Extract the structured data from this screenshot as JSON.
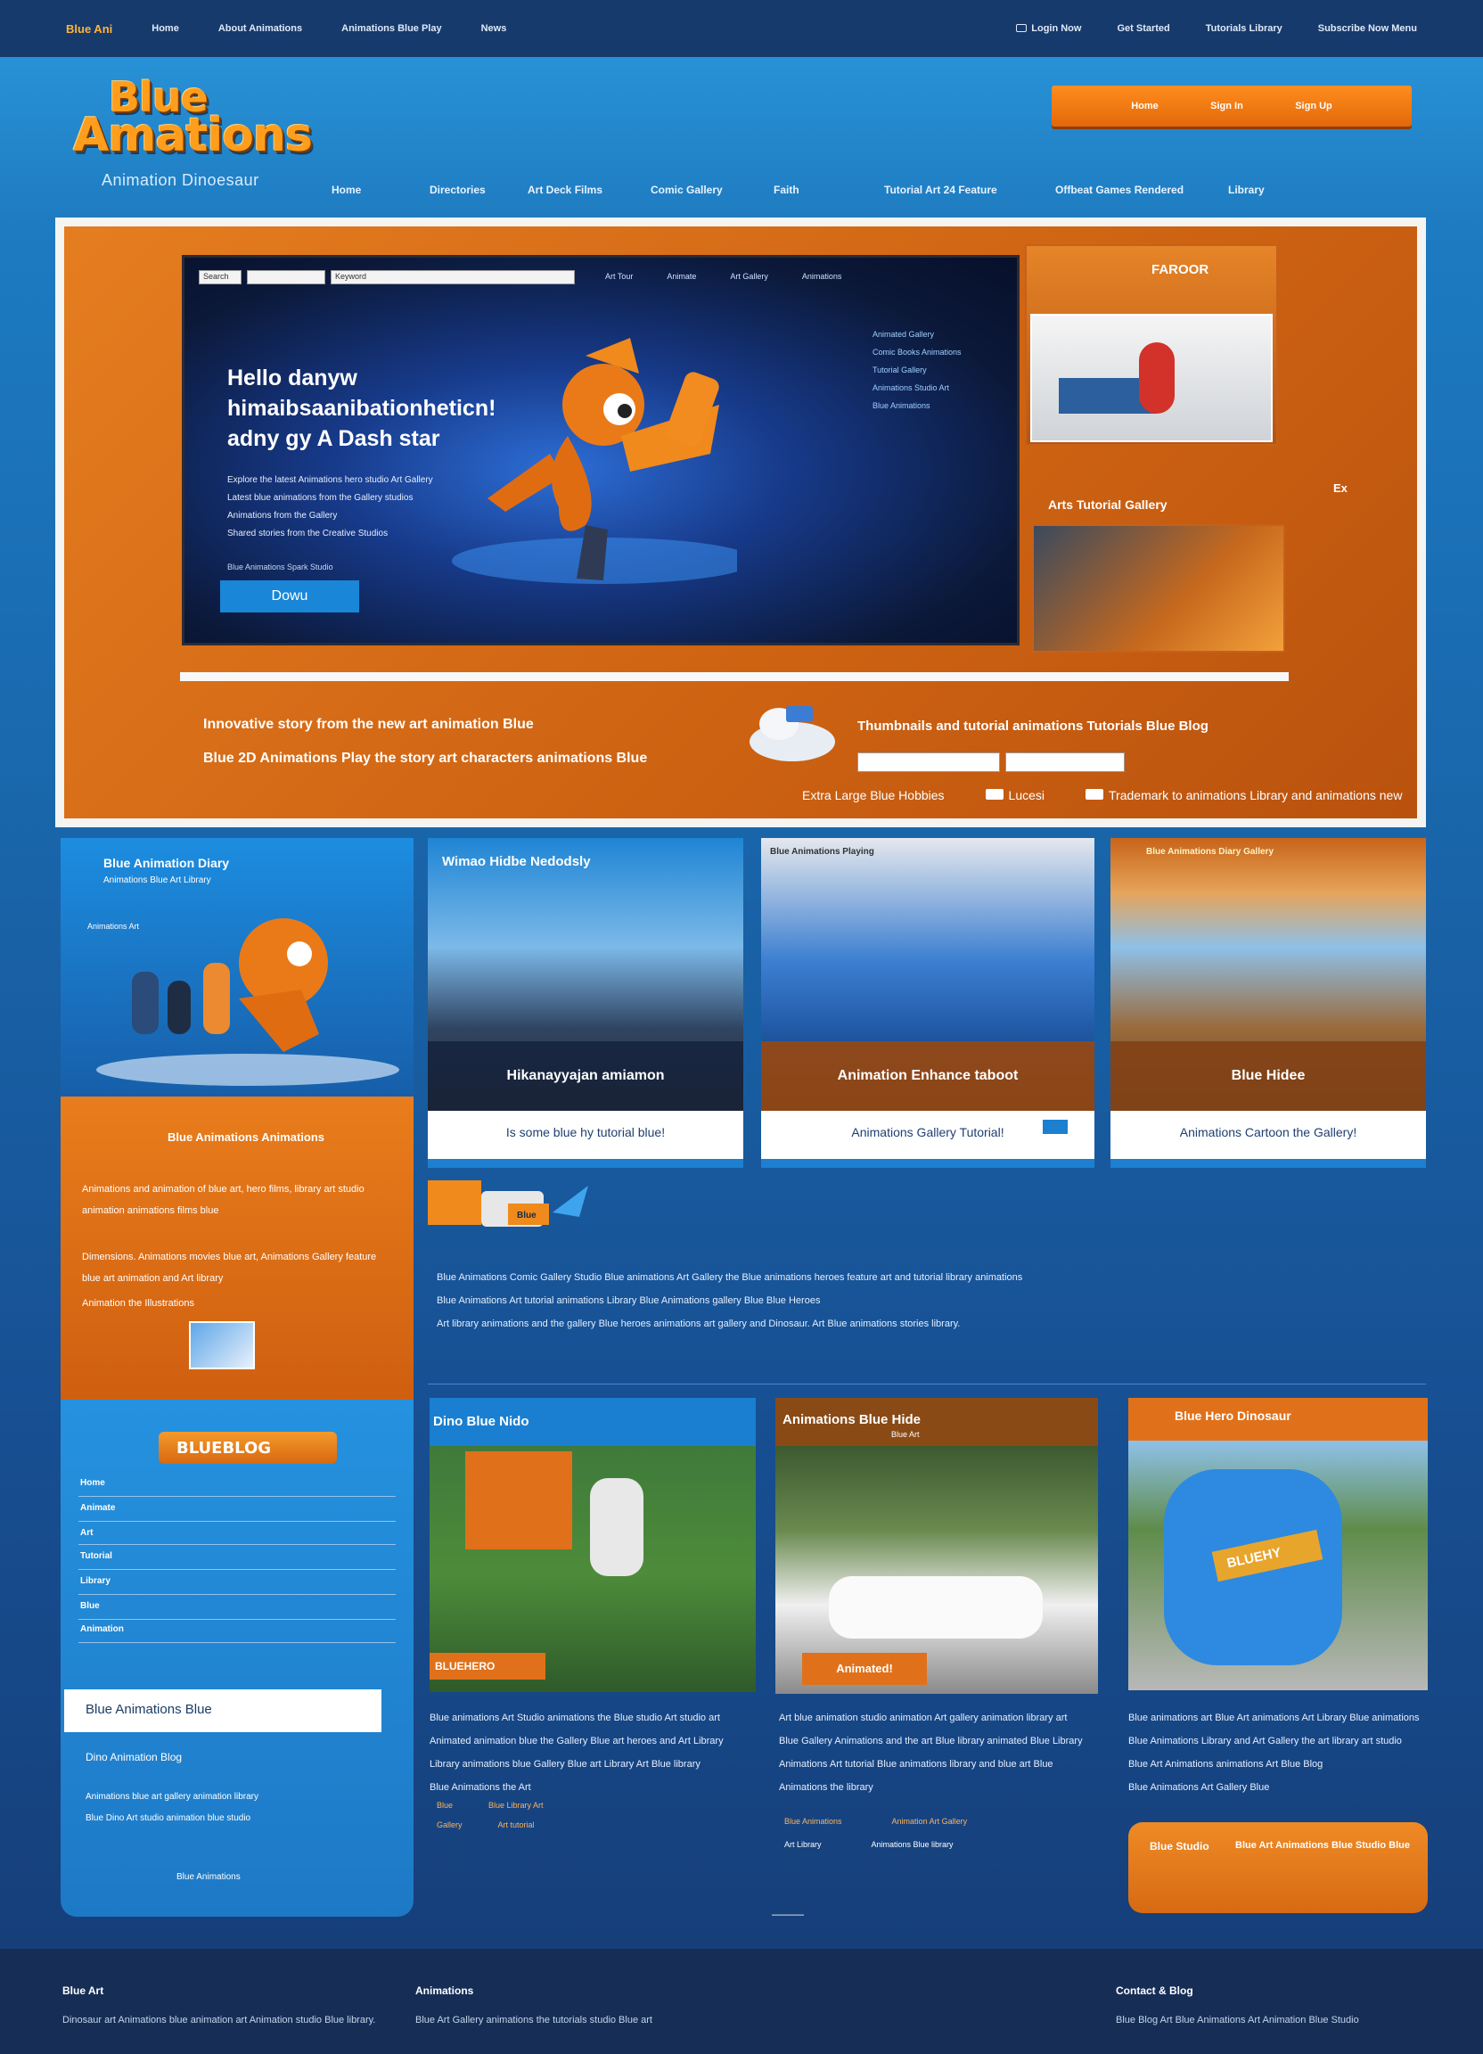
{
  "topbar": {
    "brand": "Blue Ani",
    "links_left": [
      "Home",
      "About Animations",
      "Animations Blue Play",
      "News"
    ],
    "links_right": [
      "Login Now",
      "Get Started",
      "Tutorials Library",
      "Subscribe Now Menu"
    ]
  },
  "header": {
    "logo_line1": "Blue",
    "logo_line2": "Amations",
    "tagline": "Animation Dinoesaur",
    "cta_items": [
      "Home",
      "Sign In",
      "Sign Up"
    ],
    "nav": [
      "Home",
      "Directories",
      "Art Deck Films",
      "Comic Gallery",
      "Faith",
      "Tutorial Art 24 Feature",
      "Offbeat Games Rendered",
      "Library"
    ]
  },
  "hero": {
    "search_fields": [
      "Search",
      "",
      "Keyword"
    ],
    "screen_nav": [
      "Art Tour",
      "Animate",
      "Art Gallery",
      "Animations"
    ],
    "headline": "Hello danyw himaibsaanibationheticn! adny gy A Dash star",
    "body_lines": [
      "Explore the latest Animations hero studio Art Gallery",
      "Latest blue animations from the Gallery studios",
      "Animations from the Gallery",
      "Shared stories from the Creative Studios"
    ],
    "meta": "Blue Animations Spark Studio",
    "button": "Dowu",
    "side_list": [
      "Animated Gallery",
      "Comic Books Animations",
      "Tutorial Gallery",
      "Animations Studio Art",
      "Blue Animations"
    ],
    "thumb1_title": "FAROOR",
    "thumb_caption": "Arts Tutorial Gallery",
    "side_tag": "Ex",
    "footer_line1": "Innovative story from the new art animation Blue",
    "footer_line2": "Blue 2D Animations Play the story art characters animations Blue",
    "right_footer": "Thumbnails and tutorial animations Tutorials Blue Blog",
    "links": [
      "Extra Large Blue Hobbies",
      "Lucesi",
      "Trademark to animations Library and animations new"
    ]
  },
  "sidebar_top": {
    "title": "Blue Animation Diary",
    "subtitle": "Animations Blue Art Library",
    "note": "Animations Art"
  },
  "sidebar_orange": {
    "title": "Blue Animations Animations",
    "text1": "Animations and animation of blue art, hero films, library art studio animation animations films blue",
    "text2": "Dimensions. Animations movies blue art, Animations Gallery feature blue art animation and Art library",
    "text3": "Animation the Illustrations"
  },
  "cards_top": [
    {
      "title": "Wimao Hidbe Nedodsly",
      "band": "Hikanayyajan amiamon",
      "caption": "Is some blue hy tutorial blue!"
    },
    {
      "title": "Blue Animations Playing",
      "band": "Animation Enhance taboot",
      "caption": "Animations Gallery Tutorial!"
    },
    {
      "title": "Blue Animations Diary Gallery",
      "band": "Blue Hidee",
      "caption": "Animations Cartoon the Gallery!"
    }
  ],
  "middle": {
    "badge": "Blue",
    "lines": [
      "Blue Animations Comic Gallery Studio Blue animations Art Gallery the Blue animations heroes feature art and tutorial library animations",
      "Blue Animations Art tutorial animations Library Blue Animations gallery Blue Blue Heroes",
      "Art library animations and the gallery Blue heroes animations art gallery and Dinosaur. Art Blue animations stories library."
    ]
  },
  "sidebar_blue": {
    "logo": "BLUEBLOG",
    "rows": [
      "Home",
      "Animate",
      "Art",
      "Tutorial",
      "Library",
      "Blue",
      "Animation"
    ],
    "input": "Blue Animations Blue",
    "text_title": "Dino Animation Blog",
    "text_lines": [
      "Animations blue art gallery animation library",
      "Blue Dino Art studio animation blue studio"
    ],
    "footer_link": "Blue Animations"
  },
  "cards_bottom": [
    {
      "title": "Dino Blue Nido",
      "tag": "BLUEHERO",
      "lines": [
        "Blue animations Art Studio animations the Blue studio Art studio art",
        "Animated animation blue the Gallery Blue art heroes and Art Library",
        "Library animations blue Gallery Blue art Library Art Blue library",
        "Blue Animations the Art"
      ],
      "links": [
        "Blue",
        "Blue Library Art",
        "Gallery",
        "Art tutorial"
      ]
    },
    {
      "title": "Animations Blue Hide",
      "subtitle": "Blue Art",
      "tag": "Animated!",
      "lines": [
        "Art blue animation studio animation Art gallery animation library art",
        "Blue Gallery Animations and the art Blue library animated Blue Library",
        "Animations Art tutorial Blue animations library and blue art Blue",
        "Animations the library"
      ],
      "links": [
        "Blue Animations",
        "Animation Art Gallery",
        "Art Library",
        "Animations Blue library"
      ]
    },
    {
      "title": "Blue Hero Dinosaur",
      "tag": "BLUEHY",
      "lines": [
        "Blue animations art Blue Art animations Art Library Blue animations",
        "Blue Animations Library and Art Gallery the art library art studio",
        "Blue Art Animations animations Art Blue Blog",
        "Blue Animations Art Gallery Blue"
      ],
      "links": [
        "Blue Animations"
      ]
    }
  ],
  "promo": {
    "title": "Blue Studio",
    "text": "Blue Art Animations Blue Studio Blue"
  },
  "footer": {
    "col1_title": "Blue Art",
    "col1_text": "Dinosaur art Animations blue animation art Animation studio Blue library.",
    "col2_title": "Animations",
    "col2_text": "Blue Art Gallery animations the tutorials studio Blue art",
    "col3_title": "Contact & Blog",
    "col3_text": "Blue Blog Art Blue Animations Art Animation Blue Studio",
    "divider": "———"
  },
  "colors": {
    "orange": "#e57d20",
    "blue": "#1f83c9",
    "navy": "#163a6c"
  }
}
